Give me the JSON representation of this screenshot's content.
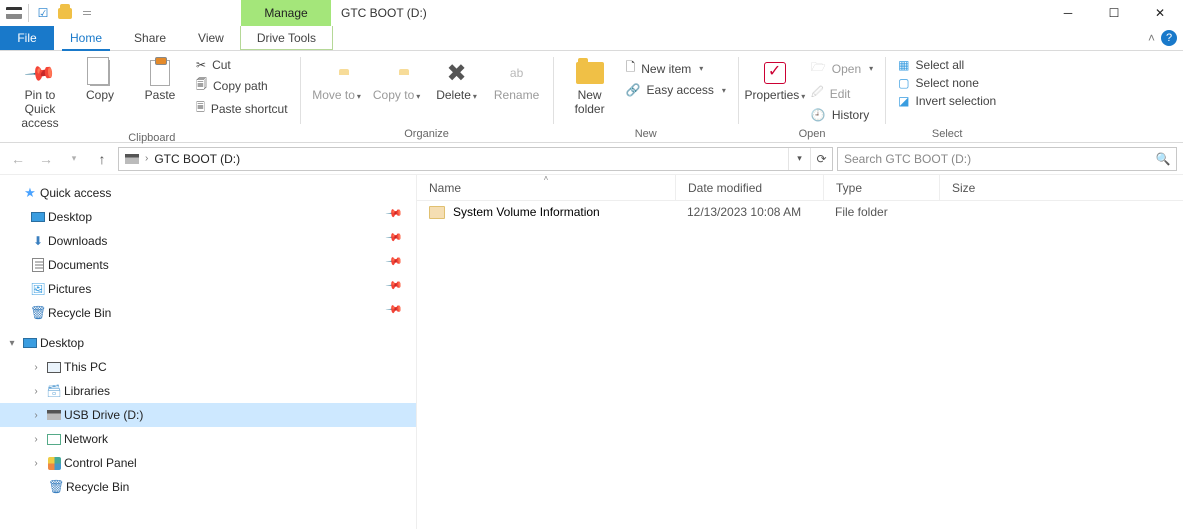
{
  "title": "GTC BOOT (D:)",
  "contextual_tab": "Manage",
  "tabs": {
    "file": "File",
    "home": "Home",
    "share": "Share",
    "view": "View",
    "drive_tools": "Drive Tools"
  },
  "ribbon": {
    "clipboard": {
      "label": "Clipboard",
      "pin_to_quick_access": "Pin to Quick access",
      "copy": "Copy",
      "paste": "Paste",
      "cut": "Cut",
      "copy_path": "Copy path",
      "paste_shortcut": "Paste shortcut"
    },
    "organize": {
      "label": "Organize",
      "move_to": "Move to",
      "copy_to": "Copy to",
      "delete": "Delete",
      "rename": "Rename"
    },
    "new": {
      "label": "New",
      "new_folder": "New folder",
      "new_item": "New item",
      "easy_access": "Easy access"
    },
    "open": {
      "label": "Open",
      "properties": "Properties",
      "open": "Open",
      "edit": "Edit",
      "history": "History"
    },
    "select": {
      "label": "Select",
      "select_all": "Select all",
      "select_none": "Select none",
      "invert_selection": "Invert selection"
    }
  },
  "addressbar": {
    "path": "GTC BOOT (D:)"
  },
  "search": {
    "placeholder": "Search GTC BOOT (D:)"
  },
  "nav": {
    "quick_access": "Quick access",
    "quick_items": [
      "Desktop",
      "Downloads",
      "Documents",
      "Pictures",
      "Recycle Bin"
    ],
    "desktop": "Desktop",
    "tree": [
      "This PC",
      "Libraries",
      "USB Drive (D:)",
      "Network",
      "Control Panel",
      "Recycle Bin"
    ]
  },
  "columns": {
    "name": "Name",
    "date": "Date modified",
    "type": "Type",
    "size": "Size"
  },
  "rows": [
    {
      "name": "System Volume Information",
      "date": "12/13/2023 10:08 AM",
      "type": "File folder",
      "size": ""
    }
  ]
}
